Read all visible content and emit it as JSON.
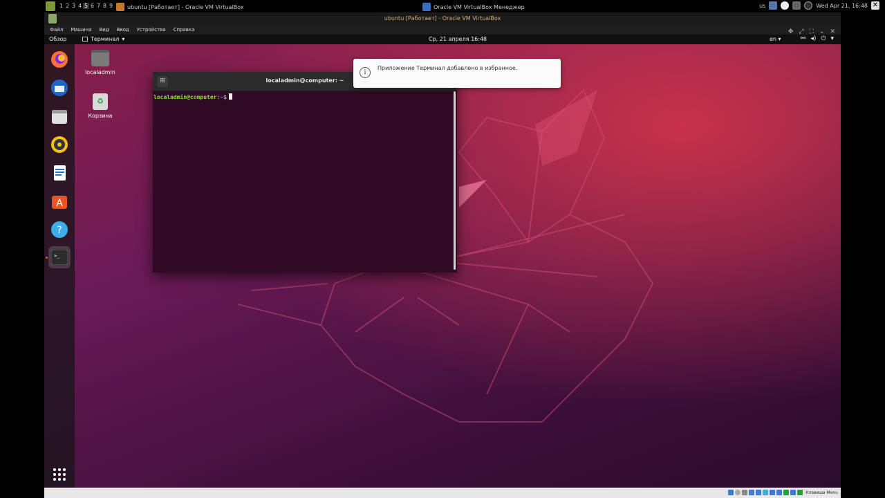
{
  "host": {
    "workspaces": [
      "1",
      "2",
      "3",
      "4",
      "5",
      "6",
      "7",
      "8",
      "9"
    ],
    "active_workspace": "5",
    "task1_label": "ubuntu [Работает] - Oracle VM VirtualBox",
    "task2_label": "Oracle VM VirtualBox Менеджер",
    "kbd": "us",
    "datetime": "Wed Apr 21, 16:48"
  },
  "vm": {
    "title": "ubuntu [Работает] - Oracle VM VirtualBox",
    "menu": [
      "Файл",
      "Машина",
      "Вид",
      "Ввод",
      "Устройства",
      "Справка"
    ],
    "status_right": "Клавиша Menu"
  },
  "gnome": {
    "activities": "Обзор",
    "app_menu": "Терминал",
    "clock": "Ср, 21 апреля  16:48",
    "lang": "en"
  },
  "dock": [
    {
      "name": "firefox-icon",
      "color": "#ff7139"
    },
    {
      "name": "thunderbird-icon",
      "color": "#3b82d6"
    },
    {
      "name": "files-icon",
      "color": "#cfcfcf"
    },
    {
      "name": "rhythmbox-icon",
      "color": "#f5c211"
    },
    {
      "name": "writer-icon",
      "color": "#2a6fc9"
    },
    {
      "name": "software-icon",
      "color": "#e95420"
    },
    {
      "name": "help-icon",
      "color": "#3daee9"
    },
    {
      "name": "terminal-icon",
      "color": "#2b2b2b"
    }
  ],
  "desktop": {
    "home_label": "localadmin",
    "trash_label": "Корзина"
  },
  "terminal": {
    "title": "localadmin@computer: ~",
    "prompt_user": "localadmin@computer",
    "prompt_sep": ":",
    "prompt_path": "~",
    "prompt_end": "$"
  },
  "notification": {
    "text": "Приложение Терминал добавлено в избранное."
  }
}
